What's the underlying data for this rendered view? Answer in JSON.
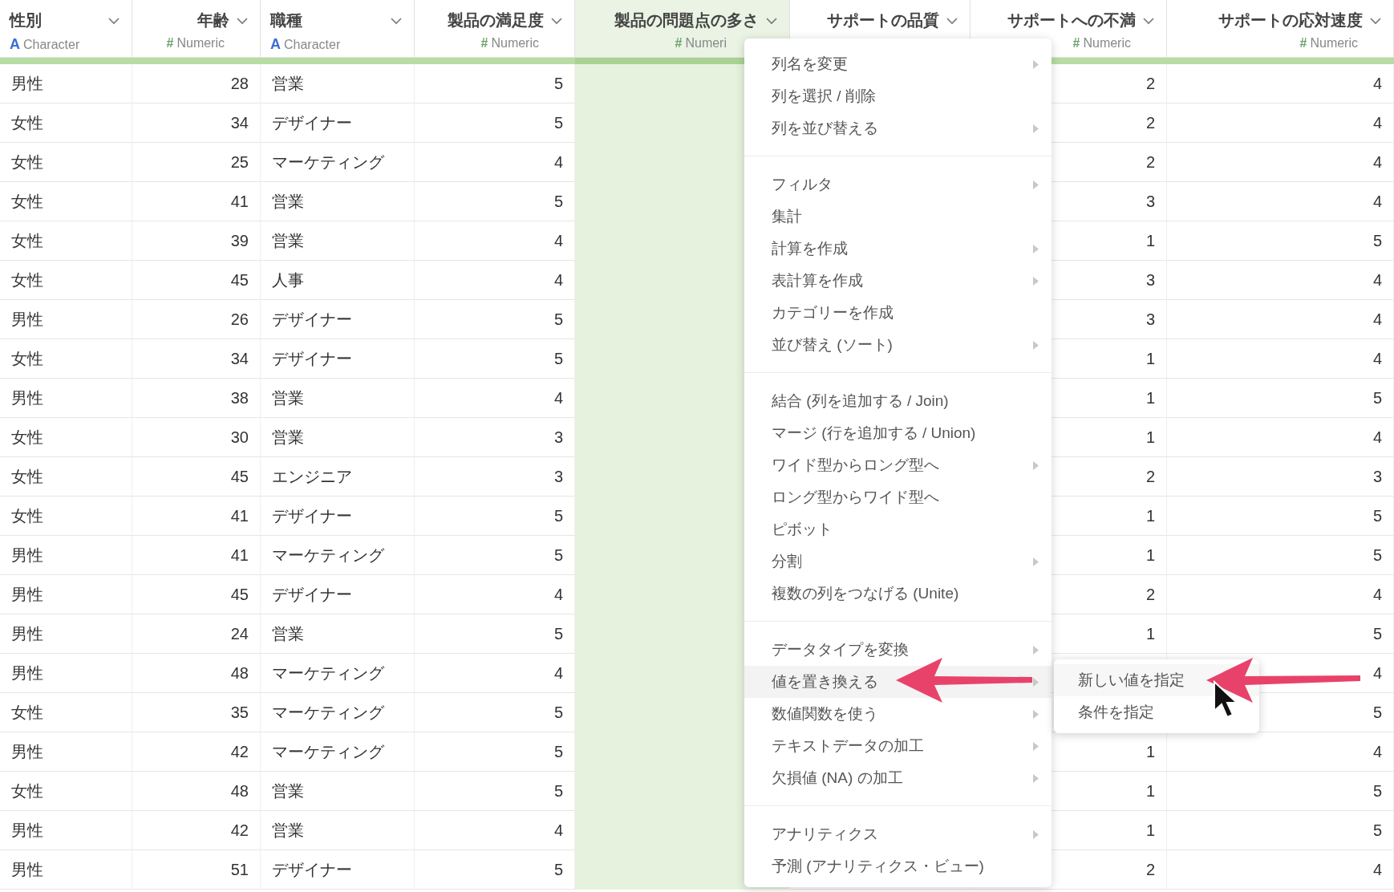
{
  "columns": [
    {
      "title": "性別",
      "kind": "character",
      "type_mark": "A",
      "type_label": "Character",
      "selected": false
    },
    {
      "title": "年齢",
      "kind": "numeric",
      "type_mark": "#",
      "type_label": "Numeric",
      "selected": false
    },
    {
      "title": "職種",
      "kind": "character",
      "type_mark": "A",
      "type_label": "Character",
      "selected": false
    },
    {
      "title": "製品の満足度",
      "kind": "numeric",
      "type_mark": "#",
      "type_label": "Numeric",
      "selected": false
    },
    {
      "title": "製品の問題点の多さ",
      "kind": "numeric",
      "type_mark": "#",
      "type_label": "Numeri",
      "selected": true
    },
    {
      "title": "サポートの品質",
      "kind": "numeric",
      "selected": false
    },
    {
      "title": "サポートへの不満",
      "kind": "numeric",
      "type_mark": "#",
      "type_label": "Numeric",
      "selected": false
    },
    {
      "title": "サポートの応対速度",
      "kind": "numeric",
      "type_mark": "#",
      "type_label": "Numeric",
      "selected": false
    }
  ],
  "rows": [
    {
      "gender": "男性",
      "age": "28",
      "job": "営業",
      "satisfaction": "5",
      "dissatisfaction": "2",
      "response_speed": "4"
    },
    {
      "gender": "女性",
      "age": "34",
      "job": "デザイナー",
      "satisfaction": "5",
      "dissatisfaction": "2",
      "response_speed": "4"
    },
    {
      "gender": "女性",
      "age": "25",
      "job": "マーケティング",
      "satisfaction": "4",
      "dissatisfaction": "2",
      "response_speed": "4"
    },
    {
      "gender": "女性",
      "age": "41",
      "job": "営業",
      "satisfaction": "5",
      "dissatisfaction": "3",
      "response_speed": "4"
    },
    {
      "gender": "女性",
      "age": "39",
      "job": "営業",
      "satisfaction": "4",
      "dissatisfaction": "1",
      "response_speed": "5"
    },
    {
      "gender": "女性",
      "age": "45",
      "job": "人事",
      "satisfaction": "4",
      "dissatisfaction": "3",
      "response_speed": "4"
    },
    {
      "gender": "男性",
      "age": "26",
      "job": "デザイナー",
      "satisfaction": "5",
      "dissatisfaction": "3",
      "response_speed": "4"
    },
    {
      "gender": "女性",
      "age": "34",
      "job": "デザイナー",
      "satisfaction": "5",
      "dissatisfaction": "1",
      "response_speed": "4"
    },
    {
      "gender": "男性",
      "age": "38",
      "job": "営業",
      "satisfaction": "4",
      "dissatisfaction": "1",
      "response_speed": "5"
    },
    {
      "gender": "女性",
      "age": "30",
      "job": "営業",
      "satisfaction": "3",
      "dissatisfaction": "1",
      "response_speed": "4"
    },
    {
      "gender": "女性",
      "age": "45",
      "job": "エンジニア",
      "satisfaction": "3",
      "dissatisfaction": "2",
      "response_speed": "3"
    },
    {
      "gender": "女性",
      "age": "41",
      "job": "デザイナー",
      "satisfaction": "5",
      "dissatisfaction": "1",
      "response_speed": "5"
    },
    {
      "gender": "男性",
      "age": "41",
      "job": "マーケティング",
      "satisfaction": "5",
      "dissatisfaction": "1",
      "response_speed": "5"
    },
    {
      "gender": "男性",
      "age": "45",
      "job": "デザイナー",
      "satisfaction": "4",
      "dissatisfaction": "2",
      "response_speed": "4"
    },
    {
      "gender": "男性",
      "age": "24",
      "job": "営業",
      "satisfaction": "5",
      "dissatisfaction": "1",
      "response_speed": "5"
    },
    {
      "gender": "男性",
      "age": "48",
      "job": "マーケティング",
      "satisfaction": "4",
      "response_speed": "4"
    },
    {
      "gender": "女性",
      "age": "35",
      "job": "マーケティング",
      "satisfaction": "5",
      "response_speed": "5"
    },
    {
      "gender": "男性",
      "age": "42",
      "job": "マーケティング",
      "satisfaction": "5",
      "dissatisfaction": "1",
      "response_speed": "4"
    },
    {
      "gender": "女性",
      "age": "48",
      "job": "営業",
      "satisfaction": "5",
      "dissatisfaction": "1",
      "response_speed": "5"
    },
    {
      "gender": "男性",
      "age": "42",
      "job": "営業",
      "satisfaction": "4",
      "dissatisfaction": "1",
      "response_speed": "5"
    },
    {
      "gender": "男性",
      "age": "51",
      "job": "デザイナー",
      "satisfaction": "5",
      "dissatisfaction": "2",
      "response_speed": "4"
    }
  ],
  "context_menu": {
    "groups": [
      [
        {
          "label": "列名を変更",
          "has_submenu": true,
          "selected": false
        },
        {
          "label": "列を選択 / 削除",
          "has_submenu": false,
          "selected": false
        },
        {
          "label": "列を並び替える",
          "has_submenu": true,
          "selected": false
        }
      ],
      [
        {
          "label": "フィルタ",
          "has_submenu": true,
          "selected": false
        },
        {
          "label": "集計",
          "has_submenu": false,
          "selected": false
        },
        {
          "label": "計算を作成",
          "has_submenu": true,
          "selected": false
        },
        {
          "label": "表計算を作成",
          "has_submenu": true,
          "selected": false
        },
        {
          "label": "カテゴリーを作成",
          "has_submenu": false,
          "selected": false
        },
        {
          "label": "並び替え (ソート)",
          "has_submenu": true,
          "selected": false
        }
      ],
      [
        {
          "label": "結合 (列を追加する / Join)",
          "has_submenu": false,
          "selected": false
        },
        {
          "label": "マージ (行を追加する / Union)",
          "has_submenu": false,
          "selected": false
        },
        {
          "label": "ワイド型からロング型へ",
          "has_submenu": true,
          "selected": false
        },
        {
          "label": "ロング型からワイド型へ",
          "has_submenu": false,
          "selected": false
        },
        {
          "label": "ピボット",
          "has_submenu": false,
          "selected": false
        },
        {
          "label": "分割",
          "has_submenu": true,
          "selected": false
        },
        {
          "label": "複数の列をつなげる (Unite)",
          "has_submenu": false,
          "selected": false
        }
      ],
      [
        {
          "label": "データタイプを変換",
          "has_submenu": true,
          "selected": false
        },
        {
          "label": "値を置き換える",
          "has_submenu": true,
          "selected": true
        },
        {
          "label": "数値関数を使う",
          "has_submenu": true,
          "selected": false
        },
        {
          "label": "テキストデータの加工",
          "has_submenu": true,
          "selected": false
        },
        {
          "label": "欠損値 (NA) の加工",
          "has_submenu": true,
          "selected": false
        }
      ],
      [
        {
          "label": "アナリティクス",
          "has_submenu": true,
          "selected": false
        },
        {
          "label": "予測 (アナリティクス・ビュー)",
          "has_submenu": false,
          "selected": false
        }
      ]
    ]
  },
  "submenu": {
    "items": [
      {
        "label": "新しい値を指定",
        "selected": true
      },
      {
        "label": "条件を指定",
        "selected": false
      }
    ]
  }
}
